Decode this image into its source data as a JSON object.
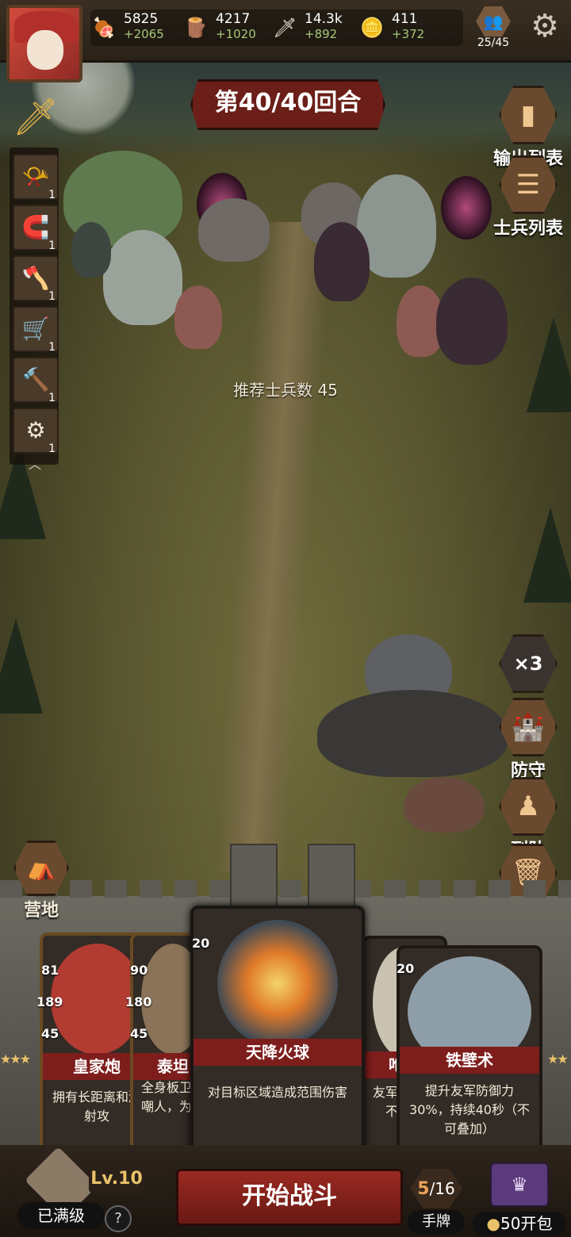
{
  "resources": [
    {
      "icon": "meat-icon",
      "value": "5825",
      "increment": "+2065"
    },
    {
      "icon": "wood-icon",
      "value": "4217",
      "increment": "+1020"
    },
    {
      "icon": "sword-icon",
      "value": "14.3k",
      "increment": "+892"
    },
    {
      "icon": "gold-coin-icon",
      "value": "411",
      "increment": "+372"
    }
  ],
  "population": "25/45",
  "round_label": "第40/40回合",
  "right_menu": {
    "output_list": "输出列表",
    "soldier_list": "士兵列表",
    "speed": "×3",
    "defend": "防守",
    "formation": "列队",
    "discard": "弃牌"
  },
  "left_skills": [
    {
      "icon": "horn-icon",
      "count": "1"
    },
    {
      "icon": "magnet-icon",
      "count": "1"
    },
    {
      "icon": "axe-icon",
      "count": "1"
    },
    {
      "icon": "cart-icon",
      "count": "1"
    },
    {
      "icon": "hammer-icon",
      "count": "1"
    },
    {
      "icon": "gear-icon",
      "count": "1"
    }
  ],
  "recommend_text": "推荐士兵数 45",
  "camp_label": "营地",
  "cards": [
    {
      "title": "皇家炮",
      "desc": "拥有长距离和溅射攻",
      "attack": "81",
      "hp": "189",
      "cost": "45"
    },
    {
      "title": "泰坦",
      "desc": "全身板卫，嘲人，为盾",
      "attack": "90",
      "hp": "180",
      "cost": "45"
    },
    {
      "title": "天降火球",
      "desc": "对目标区域造成范围伤害",
      "cost": "20"
    },
    {
      "title": "咆哮",
      "desc": "友军攻持续不可叠",
      "cost": ""
    },
    {
      "title": "铁壁术",
      "desc": "提升友军防御力30%，持续40秒（不可叠加）",
      "cost": "20"
    }
  ],
  "bottom": {
    "max_level": "已满级",
    "level": "Lv.10",
    "help": "?",
    "start_battle": "开始战斗",
    "hand_current": "5",
    "hand_total": "/16",
    "hand_label": "手牌",
    "pack_price": "50",
    "pack_label": "开包"
  }
}
